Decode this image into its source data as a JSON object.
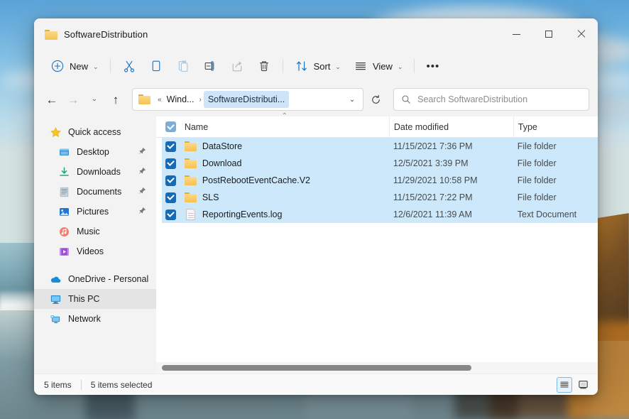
{
  "window": {
    "title": "SoftwareDistribution",
    "title_icon": "folder-icon",
    "controls": {
      "minimize": "minimize-icon",
      "maximize": "maximize-icon",
      "close": "close-icon"
    }
  },
  "toolbar": {
    "new_label": "New",
    "new_chevron": "⌄",
    "cut_label": "cut-icon",
    "copy_label": "copy-icon",
    "paste_label": "paste-icon",
    "rename_label": "rename-icon",
    "share_label": "share-icon",
    "delete_label": "delete-icon",
    "sort_label": "Sort",
    "sort_chevron": "⌄",
    "view_label": "View",
    "view_chevron": "⌄",
    "more_label": "•••"
  },
  "navbar": {
    "back": "←",
    "forward": "→",
    "recent_chevron": "⌄",
    "up": "↑",
    "breadcrumb": {
      "overflow": "«",
      "parent": "Wind...",
      "separator": "›",
      "current": "SoftwareDistributi..."
    },
    "address_dropdown": "⌄",
    "refresh": "refresh-icon",
    "search_placeholder": "Search SoftwareDistribution"
  },
  "sidebar": {
    "groups": [
      {
        "header": {
          "label": "Quick access",
          "icon": "star-icon"
        },
        "items": [
          {
            "label": "Desktop",
            "icon": "desktop-icon",
            "pinned": true
          },
          {
            "label": "Downloads",
            "icon": "downloads-icon",
            "pinned": true
          },
          {
            "label": "Documents",
            "icon": "documents-icon",
            "pinned": true
          },
          {
            "label": "Pictures",
            "icon": "pictures-icon",
            "pinned": true
          },
          {
            "label": "Music",
            "icon": "music-icon",
            "pinned": false
          },
          {
            "label": "Videos",
            "icon": "videos-icon",
            "pinned": false
          }
        ]
      }
    ],
    "roots": [
      {
        "label": "OneDrive - Personal",
        "icon": "onedrive-icon",
        "selected": false
      },
      {
        "label": "This PC",
        "icon": "thispc-icon",
        "selected": true
      },
      {
        "label": "Network",
        "icon": "network-icon",
        "selected": false
      }
    ],
    "pin_glyph": "📌"
  },
  "file_list": {
    "select_all_checked": true,
    "sort_column": "Name",
    "sort_direction": "ascending",
    "sort_caret": "⌃",
    "columns": [
      {
        "key": "name",
        "label": "Name"
      },
      {
        "key": "date",
        "label": "Date modified"
      },
      {
        "key": "type",
        "label": "Type"
      }
    ],
    "rows": [
      {
        "name": "DataStore",
        "date": "11/15/2021 7:36 PM",
        "type": "File folder",
        "icon": "folder-icon",
        "selected": true
      },
      {
        "name": "Download",
        "date": "12/5/2021 3:39 PM",
        "type": "File folder",
        "icon": "folder-icon",
        "selected": true
      },
      {
        "name": "PostRebootEventCache.V2",
        "date": "11/29/2021 10:58 PM",
        "type": "File folder",
        "icon": "folder-icon",
        "selected": true
      },
      {
        "name": "SLS",
        "date": "11/15/2021 7:22 PM",
        "type": "File folder",
        "icon": "folder-icon",
        "selected": true
      },
      {
        "name": "ReportingEvents.log",
        "date": "12/6/2021 11:39 AM",
        "type": "Text Document",
        "icon": "text-file-icon",
        "selected": true
      }
    ]
  },
  "statusbar": {
    "item_count": "5 items",
    "selection_count": "5 items selected",
    "view_details": "details-view-icon",
    "view_large_icons": "large-icons-view-icon"
  },
  "colors": {
    "accent": "#0f6cbd",
    "selection_row": "#cde8fb",
    "window_chrome": "#f3f3f3",
    "breadcrumb_current": "#cfe4f7",
    "toolbar_icon_blue": "#1a73c4"
  }
}
